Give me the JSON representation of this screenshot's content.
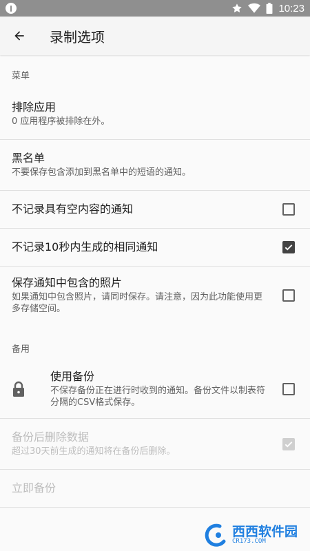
{
  "status_bar": {
    "time": "10:23",
    "icons": [
      "alert-icon",
      "star-icon",
      "wifi-icon",
      "battery-icon"
    ]
  },
  "app_bar": {
    "title": "录制选项",
    "back_icon": "arrow-back-icon"
  },
  "sections": {
    "menu_header": "菜单",
    "backup_header": "备用"
  },
  "prefs": {
    "exclude_apps": {
      "title": "排除应用",
      "summary": "0 应用程序被排除在外。"
    },
    "blacklist": {
      "title": "黑名单",
      "summary": "不要保存包含添加到黑名单中的短语的通知。"
    },
    "skip_empty": {
      "title": "不记录具有空内容的通知",
      "checked": false
    },
    "skip_duplicate": {
      "title": "不记录10秒内生成的相同通知",
      "checked": true
    },
    "save_photos": {
      "title": "保存通知中包含的照片",
      "summary": "如果通知中包含照片，请同时保存。请注意，因为此功能使用更多存储空间。",
      "checked": false
    },
    "use_backup": {
      "title": "使用备份",
      "summary": "不保存备份正在进行时收到的通知。备份文件以制表符分隔的CSV格式保存。",
      "checked": false,
      "icon": "lock-icon"
    },
    "delete_after_backup": {
      "title": "备份后删除数据",
      "summary": "超过30天前生成的通知将在备份后删除。",
      "checked": true,
      "enabled": false
    },
    "backup_now": {
      "title": "立即备份",
      "enabled": false
    }
  },
  "watermark": {
    "brand": "西西软件园",
    "domain": "CR173.COM"
  },
  "colors": {
    "status_bar": "#8f8f8f",
    "app_bar": "#f5f5f5",
    "background": "#fafafa",
    "checkbox_checked": "#424242",
    "disabled_text": "#bdbdbd",
    "watermark": "#1f7fe0"
  }
}
